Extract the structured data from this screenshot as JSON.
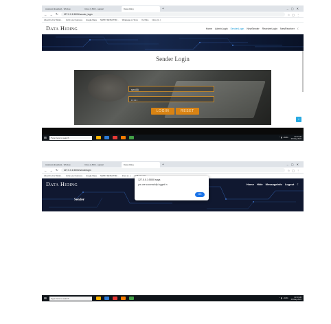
{
  "colors": {
    "accent": "#1a9bd7",
    "button": "#d98313",
    "hero_dark": "#101830",
    "dialog_ok": "#1a73e8"
  },
  "screen1": {
    "tabs": [
      "Assistant (Enabled) - Window",
      "Inbox (1,603) - saipakl",
      "Data Hiding"
    ],
    "url": "127.0.0.1:5000/sender_login",
    "bookmarks": [
      "About the For Binder...",
      "Verify your business",
      "Google Maps",
      "NIMIST DETECTOR...",
      "Whatsapp on Temp",
      "YouTube",
      "Inbox (1...)"
    ],
    "logo": "Data Hiding",
    "nav": [
      "Home",
      "AdminLogin",
      "SenderLogin",
      "NewSender",
      "ReceiverLogin",
      "NewReceiver"
    ],
    "nav_current": "SenderLogin",
    "page_title": "Sender Login",
    "username_value": "sen55",
    "password_value": "•••••",
    "login_label": "LOGIN",
    "reset_label": "RESET",
    "taskbar_search": "Type here to search",
    "tray_time": "11:33 AM",
    "tray_date": "06-May-2024"
  },
  "screen2": {
    "tabs": [
      "Assistant (Enabled) - Window",
      "Inbox (1,603) - saipakl",
      "Data Hiding"
    ],
    "url": "127.0.0.1:5000/senderlogin",
    "bookmarks": [
      "About the For Binder...",
      "Verify your business",
      "Google Maps",
      "NIMIST DETECTOR...",
      "Inbox (1...)",
      "All Bookmarks"
    ],
    "logo": "Data Hiding",
    "nav": [
      "Home",
      "Hide",
      "MessageInfo",
      "Logout"
    ],
    "section_label": "Sender",
    "dialog_title": "127.0.0.1:5000 says",
    "dialog_message": "you are successfully logged in",
    "dialog_ok": "OK",
    "taskbar_search": "Type here to search",
    "tray_time": "11:33 AM",
    "tray_date": "06-May-2024"
  }
}
